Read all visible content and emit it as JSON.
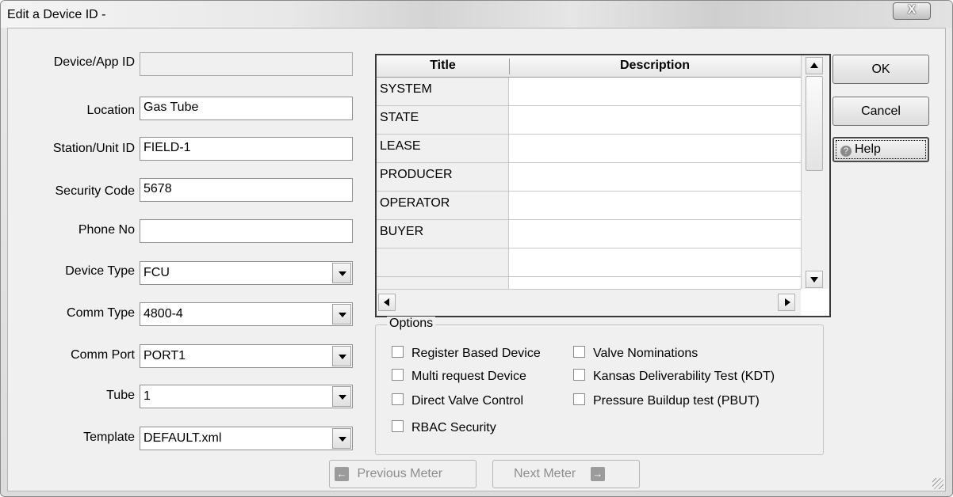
{
  "window": {
    "title": "Edit a Device ID -",
    "close_glyph": "X"
  },
  "form": {
    "fields": [
      {
        "label": "Device/App ID",
        "value": "",
        "type": "text",
        "disabled": true
      },
      {
        "label": "Location",
        "value": "Gas Tube",
        "type": "text"
      },
      {
        "label": "Station/Unit ID",
        "value": "FIELD-1",
        "type": "text"
      },
      {
        "label": "Security Code",
        "value": "5678",
        "type": "text"
      },
      {
        "label": "Phone No",
        "value": "",
        "type": "text"
      },
      {
        "label": "Device Type",
        "value": "FCU",
        "type": "select"
      },
      {
        "label": "Comm Type",
        "value": "4800-4",
        "type": "select"
      },
      {
        "label": "Comm Port",
        "value": "PORT1",
        "type": "select"
      },
      {
        "label": "Tube",
        "value": "1",
        "type": "select"
      },
      {
        "label": "Template",
        "value": "DEFAULT.xml",
        "type": "select"
      }
    ]
  },
  "grid": {
    "columns": [
      "Title",
      "Description"
    ],
    "rows": [
      {
        "title": "SYSTEM",
        "description": ""
      },
      {
        "title": "STATE",
        "description": ""
      },
      {
        "title": "LEASE",
        "description": ""
      },
      {
        "title": "PRODUCER",
        "description": ""
      },
      {
        "title": "OPERATOR",
        "description": ""
      },
      {
        "title": "BUYER",
        "description": ""
      },
      {
        "title": "",
        "description": ""
      },
      {
        "title": "",
        "description": ""
      }
    ]
  },
  "buttons": {
    "ok": "OK",
    "cancel": "Cancel",
    "help": "Help"
  },
  "options": {
    "legend": "Options",
    "items": [
      {
        "label": "Register Based Device",
        "checked": false
      },
      {
        "label": "Multi request Device",
        "checked": false
      },
      {
        "label": "Direct Valve Control",
        "checked": false
      },
      {
        "label": "RBAC Security",
        "checked": false
      },
      {
        "label": "Valve Nominations",
        "checked": false
      },
      {
        "label": "Kansas Deliverability Test (KDT)",
        "checked": false
      },
      {
        "label": "Pressure Buildup test (PBUT)",
        "checked": false
      }
    ]
  },
  "navigation": {
    "previous": "Previous Meter",
    "next": "Next Meter",
    "enabled": false
  },
  "icons": {
    "help": "help-icon",
    "previous": "arrow-left-icon",
    "next": "arrow-right-icon"
  }
}
